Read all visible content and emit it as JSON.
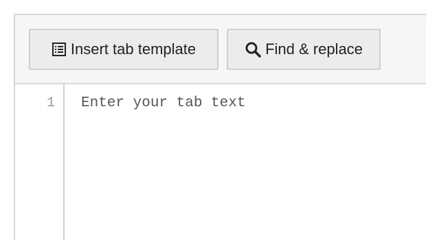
{
  "toolbar": {
    "insert_template_label": "Insert tab template",
    "insert_template_icon": "list-icon",
    "find_replace_label": "Find & replace",
    "find_replace_icon": "search-icon"
  },
  "editor": {
    "line_numbers": [
      "1"
    ],
    "placeholder": "Enter your tab text"
  }
}
